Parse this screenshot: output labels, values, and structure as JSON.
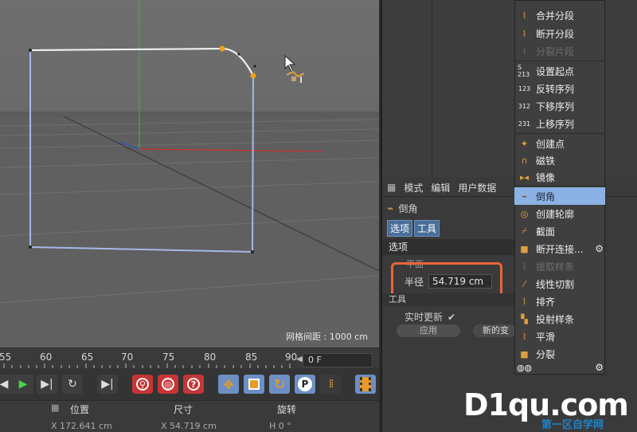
{
  "viewport": {
    "grid_readout": "网格间距 : 1000 cm"
  },
  "timeline": {
    "ticks": [
      "55",
      "60",
      "65",
      "70",
      "75",
      "80",
      "85",
      "90"
    ],
    "frame_value": "0 F"
  },
  "coordinates": {
    "position": "位置",
    "size": "尺寸",
    "rotation": "旋转",
    "position_value": "X  172.641 cm",
    "size_value": "X  54.719 cm",
    "rotation_value": "H  0 °"
  },
  "attribute_manager": {
    "menu": [
      "模式",
      "编辑",
      "用户数据"
    ],
    "object_title": "倒角",
    "tabs": [
      "选项",
      "工具"
    ],
    "section": "选项",
    "plane_label": "平面",
    "radius_label": "半径",
    "radius_value": "54.719 cm",
    "tool_section": "工具",
    "realtime_label": "实时更新",
    "realtime_checked": "✔",
    "apply_label": "应用",
    "new_label": "新的变"
  },
  "context_menu": {
    "items": [
      {
        "label": "合并分段",
        "icon": "merge-segment-icon",
        "disabled": false
      },
      {
        "label": "断开分段",
        "icon": "break-segment-icon",
        "disabled": false
      },
      {
        "label": "分裂片段",
        "icon": "explode-segments-icon",
        "disabled": true
      },
      {
        "label": "设置起点",
        "icon": "set-first-point-icon",
        "disabled": false
      },
      {
        "label": "反转序列",
        "icon": "reverse-sequence-icon",
        "disabled": false
      },
      {
        "label": "下移序列",
        "icon": "move-down-sequence-icon",
        "disabled": false
      },
      {
        "label": "上移序列",
        "icon": "move-up-sequence-icon",
        "disabled": false
      },
      {
        "label": "创建点",
        "icon": "create-point-icon",
        "disabled": false
      },
      {
        "label": "磁铁",
        "icon": "magnet-icon",
        "disabled": false
      },
      {
        "label": "镜像",
        "icon": "mirror-icon",
        "disabled": false
      },
      {
        "label": "倒角",
        "icon": "chamfer-icon",
        "disabled": false,
        "selected": true
      },
      {
        "label": "创建轮廓",
        "icon": "create-outline-icon",
        "disabled": false
      },
      {
        "label": "截面",
        "icon": "cross-section-icon",
        "disabled": false
      },
      {
        "label": "断开连接...",
        "icon": "disconnect-icon",
        "disabled": false
      },
      {
        "label": "提取样条",
        "icon": "extract-spline-icon",
        "disabled": true
      },
      {
        "label": "线性切割",
        "icon": "line-cut-icon",
        "disabled": false
      },
      {
        "label": "排齐",
        "icon": "align-icon",
        "disabled": false
      },
      {
        "label": "投射样条",
        "icon": "project-spline-icon",
        "disabled": false
      },
      {
        "label": "平滑",
        "icon": "smooth-icon",
        "disabled": false
      },
      {
        "label": "分裂",
        "icon": "split-icon",
        "disabled": false
      }
    ]
  },
  "watermark": {
    "main": "D1qu.com",
    "sub": "第一区自学网"
  },
  "colors": {
    "accent_orange": "#e8643a",
    "menu_highlight": "#8cb1e4",
    "spline_line": "#a6b8e8",
    "x_axis": "#d03030",
    "y_axis": "#3ab03a"
  }
}
